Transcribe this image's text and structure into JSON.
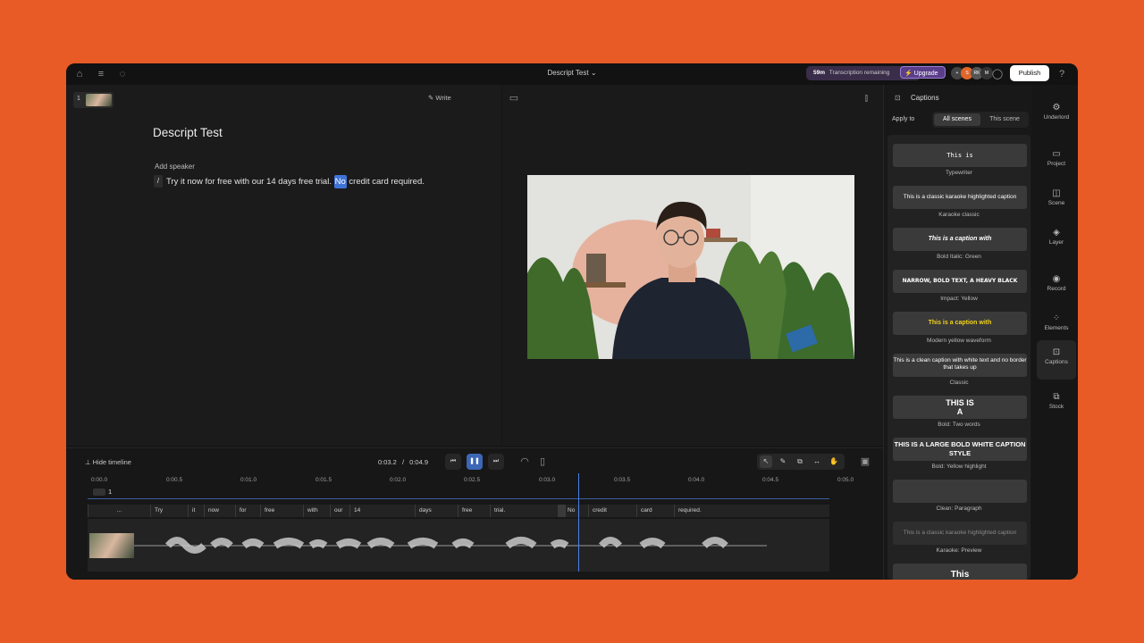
{
  "topbar": {
    "title": "Descript Test",
    "transcribe_minutes": "59m",
    "transcribe_label": "Transcription remaining",
    "upgrade_label": "Upgrade",
    "avatar1": "S",
    "avatar2": "RK",
    "avatar3": "M",
    "publish_label": "Publish"
  },
  "editor": {
    "scene_number": "1",
    "write_label": "Write",
    "doc_title": "Descript Test",
    "add_speaker": "Add speaker",
    "slash": "/",
    "text_before": "Try it now for free with our 14 days free trial.",
    "text_highlight": "No",
    "text_after": "credit card required."
  },
  "timeline": {
    "hide_label": "Hide timeline",
    "current_time": "0:03.2",
    "separator": "/",
    "total_time": "0:04.9",
    "ticks": [
      "0:00.0",
      "0:00.5",
      "0:01.0",
      "0:01.5",
      "0:02.0",
      "0:02.5",
      "0:03.0",
      "0:03.5",
      "0:04.0",
      "0:04.5",
      "0:05.0"
    ],
    "track_label": "1",
    "words": [
      "...",
      "Try",
      "it",
      "now",
      "for",
      "free",
      "with",
      "our",
      "14",
      "days",
      "free",
      "trial.",
      "",
      "No",
      "credit",
      "card",
      "required."
    ]
  },
  "captions": {
    "title": "Captions",
    "apply_to": "Apply to",
    "seg_all": "All scenes",
    "seg_this": "This scene",
    "styles": [
      {
        "preview": "This is",
        "name": "Typewriter"
      },
      {
        "preview": "This is a classic karaoke highlighted caption",
        "name": "Karaoke classic"
      },
      {
        "preview": "This is a caption with",
        "name": "Bold Italic: Green"
      },
      {
        "preview": "NARROW, BOLD TEXT, A HEAVY BLACK",
        "name": "Impact: Yellow"
      },
      {
        "preview": "This is a caption with",
        "name": "Modern yellow waveform"
      },
      {
        "preview": "This is a clean caption with white text and no border that takes up",
        "name": "Classic"
      },
      {
        "preview": "THIS IS A",
        "name": "Bold: Two words"
      },
      {
        "preview": "THIS IS A LARGE BOLD WHITE CAPTION STYLE",
        "name": "Bold: Yellow highlight"
      },
      {
        "preview": "",
        "name": "Clean: Paragraph"
      },
      {
        "preview": "This is a classic karaoke highlighted caption",
        "name": "Karaoke: Preview"
      },
      {
        "preview": "This",
        "name": ""
      }
    ]
  },
  "sidenav": {
    "items": [
      {
        "label": "Underlord"
      },
      {
        "label": "Project"
      },
      {
        "label": "Scene"
      },
      {
        "label": "Layer"
      },
      {
        "label": "Record"
      },
      {
        "label": "Elements"
      },
      {
        "label": "Captions"
      },
      {
        "label": "Stock"
      }
    ]
  },
  "colors": {
    "accent": "#3f73d8",
    "background": "#e85a26",
    "upgrade": "#5a3e8a"
  }
}
